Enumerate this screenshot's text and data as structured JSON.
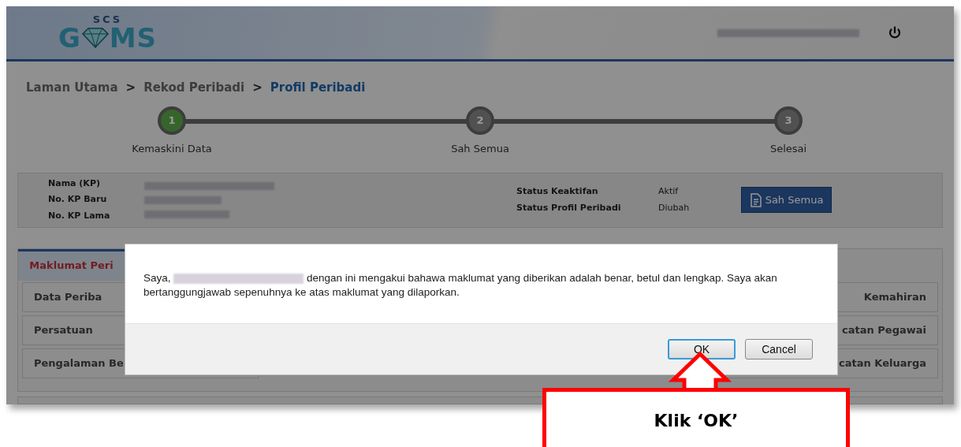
{
  "header": {
    "logo": {
      "top": "SCS",
      "left": "G",
      "right": "MS"
    }
  },
  "breadcrumb": [
    {
      "label": "Laman Utama",
      "current": false
    },
    {
      "label": "Rekod Peribadi",
      "current": false
    },
    {
      "label": "Profil Peribadi",
      "current": true
    }
  ],
  "separator": ">",
  "steps": [
    {
      "number": "1",
      "label": "Kemaskini Data",
      "done": true
    },
    {
      "number": "2",
      "label": "Sah Semua",
      "done": false
    },
    {
      "number": "3",
      "label": "Selesai",
      "done": false
    }
  ],
  "profile": {
    "fields": [
      {
        "label": "Nama (KP)"
      },
      {
        "label": "No. KP Baru"
      },
      {
        "label": "No. KP Lama"
      }
    ],
    "status": [
      {
        "label": "Status Keaktifan",
        "value": "Aktif"
      },
      {
        "label": "Status Profil Peribadi",
        "value": "Diubah"
      }
    ],
    "button": "Sah Semua"
  },
  "tabs": [
    {
      "label": "Maklumat Peri",
      "selected": true
    }
  ],
  "sections_left": [
    "Data Periba",
    "Persatuan",
    "Pengalaman Be"
  ],
  "sections_right": [
    "Kemahiran",
    "catan Pegawai",
    "catan Keluarga"
  ],
  "dialog": {
    "message_before": "Saya,",
    "message_after": "dengan ini mengakui bahawa maklumat yang diberikan adalah benar, betul dan lengkap. Saya akan bertanggungjawab sepenuhnya ke atas maklumat yang dilaporkan.",
    "buttons": [
      {
        "label": "OK",
        "focused": true
      },
      {
        "label": "Cancel",
        "focused": false
      }
    ]
  },
  "callout": {
    "text": "Klik ‘OK’"
  }
}
